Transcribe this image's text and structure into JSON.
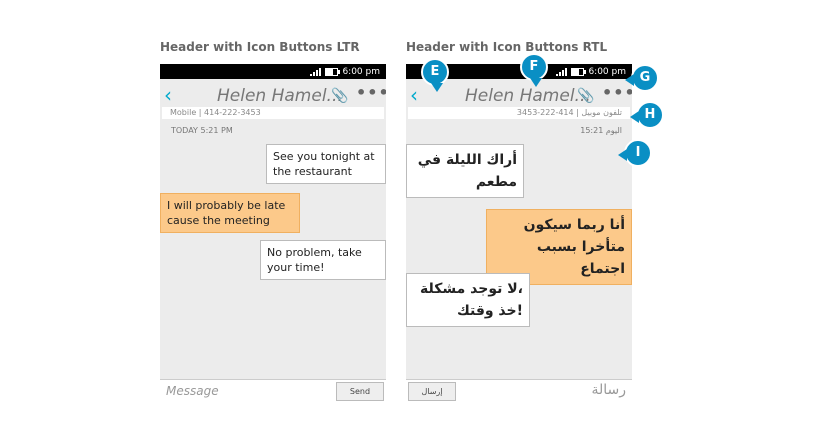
{
  "ltr": {
    "title": "Header with Icon Buttons  LTR",
    "time": "6:00 pm",
    "back": "‹",
    "name": "Helen Hamel...",
    "clip": "📎",
    "menu": "•••",
    "sub": "Mobile  |  414-222-3453",
    "date": "TODAY  5:21 PM",
    "messages": [
      "See you tonight at the restaurant",
      "I will probably be late cause the meeting",
      "No problem, take your time!"
    ],
    "input_placeholder": "Message",
    "send": "Send"
  },
  "rtl": {
    "title": "Header with Icon Buttons RTL",
    "time": "6:00 pm",
    "back": "‹",
    "name": "Helen Hamel...",
    "clip": "📎",
    "menu": "•••",
    "sub": "تلفون موبيل  |  414-222-3453",
    "date": "اليوم 15:21",
    "messages": [
      "أراك الليلة في مطعم",
      "أنا ربما سيكون متأخرا بسبب اجتماع",
      "،لا توجد مشكلة !خذ وقتك"
    ],
    "input_placeholder": "رسالة",
    "send": "إرسال"
  },
  "markers": [
    "E",
    "F",
    "G",
    "H",
    "I"
  ],
  "colors": {
    "accent": "#00aacc",
    "marker": "#0a8fc4",
    "outgoing": "#fcc98a"
  }
}
